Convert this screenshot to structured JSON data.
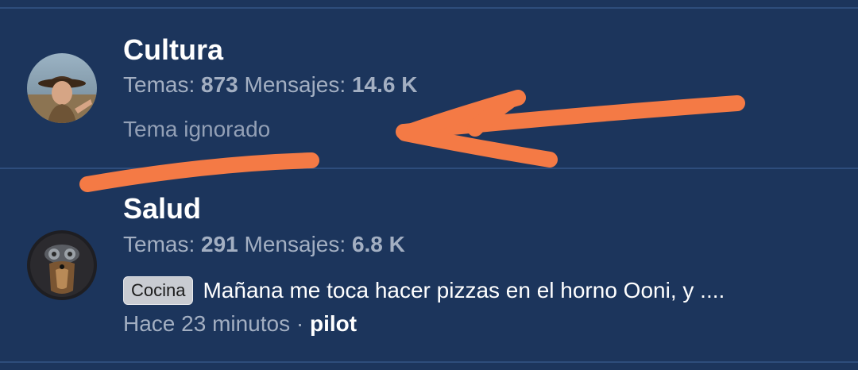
{
  "forums": [
    {
      "title": "Cultura",
      "stats": {
        "topics_label": "Temas:",
        "topics_value": "873",
        "messages_label": "Mensajes:",
        "messages_value": "14.6 K"
      },
      "last_post_status": "Tema ignorado"
    },
    {
      "title": "Salud",
      "stats": {
        "topics_label": "Temas:",
        "topics_value": "291",
        "messages_label": "Mensajes:",
        "messages_value": "6.8 K"
      },
      "last_post": {
        "tag": "Cocina",
        "title": "Mañana me toca hacer pizzas en el horno Ooni, y ....",
        "time": "Hace 23 minutos",
        "separator": "·",
        "author": "pilot"
      }
    }
  ],
  "colors": {
    "background": "#1c355c",
    "annotation": "#f47a45",
    "title_text": "#ffffff",
    "muted_text": "#a3afc2"
  },
  "annotation_icon": "hand-drawn-arrow-and-underline"
}
